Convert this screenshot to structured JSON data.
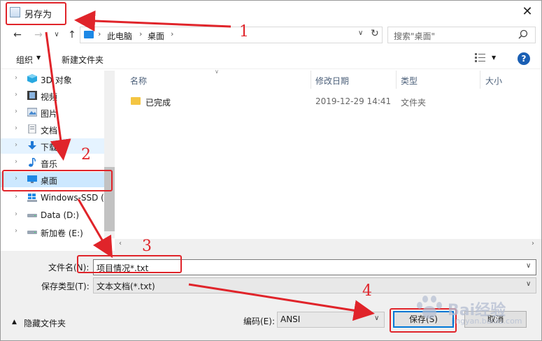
{
  "window": {
    "title": "另存为",
    "close_glyph": "✕"
  },
  "nav": {
    "back_glyph": "←",
    "forward_glyph": "→",
    "recent_glyph": "∨",
    "up_glyph": "↑",
    "breadcrumb": [
      "此电脑",
      "桌面"
    ],
    "search_placeholder": "搜索\"桌面\""
  },
  "toolbar": {
    "organize": "组织",
    "new_folder": "新建文件夹"
  },
  "tree": {
    "items": [
      {
        "label": "3D 对象",
        "icon": "cube-icon"
      },
      {
        "label": "视频",
        "icon": "film-icon"
      },
      {
        "label": "图片",
        "icon": "picture-icon"
      },
      {
        "label": "文档",
        "icon": "document-icon"
      },
      {
        "label": "下载",
        "icon": "download-icon"
      },
      {
        "label": "音乐",
        "icon": "music-icon"
      },
      {
        "label": "桌面",
        "icon": "desktop-icon"
      },
      {
        "label": "Windows-SSD (",
        "icon": "windows-drive-icon"
      },
      {
        "label": "Data (D:)",
        "icon": "drive-icon"
      },
      {
        "label": "新加卷 (E:)",
        "icon": "drive-icon"
      }
    ],
    "selected_index": 6
  },
  "list": {
    "columns": [
      "名称",
      "修改日期",
      "类型",
      "大小"
    ],
    "rows": [
      {
        "name": "已完成",
        "date": "2019-12-29 14:41",
        "type": "文件夹"
      }
    ]
  },
  "form": {
    "filename_label": "文件名(N):",
    "filename_value": "项目情况*.txt",
    "filetype_label": "保存类型(T):",
    "filetype_value": "文本文档(*.txt)",
    "hide_folders": "隐藏文件夹",
    "encoding_label": "编码(E):",
    "encoding_value": "ANSI",
    "save": "保存(S)",
    "cancel": "取消"
  },
  "annotations": {
    "step1": "1",
    "step2": "2",
    "step3": "3",
    "step4": "4",
    "color": "#e0242a"
  },
  "watermark": {
    "text": "Bai经验",
    "url": "jingyan.baidu.com"
  }
}
